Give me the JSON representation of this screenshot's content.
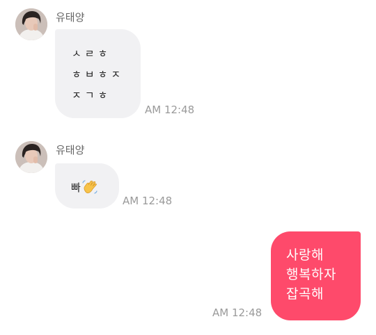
{
  "messages": [
    {
      "sender": "유태양",
      "avatar": "profile-photo",
      "lines": [
        "ㅅㄹㅎ",
        "ㅎㅂㅎㅈ",
        "ㅈㄱㅎ"
      ],
      "time": "AM 12:48"
    },
    {
      "sender": "유태양",
      "avatar": "profile-photo",
      "text": "빠",
      "emoji": "waving-hand-icon",
      "time": "AM 12:48"
    },
    {
      "lines": [
        "사랑해",
        "행복하자",
        "잡곡해"
      ],
      "time": "AM 12:48"
    }
  ],
  "colors": {
    "incoming_bubble": "#f1f1f3",
    "outgoing_bubble": "#fe4a6b",
    "time_text": "#9a9a9a",
    "name_text": "#666666"
  }
}
